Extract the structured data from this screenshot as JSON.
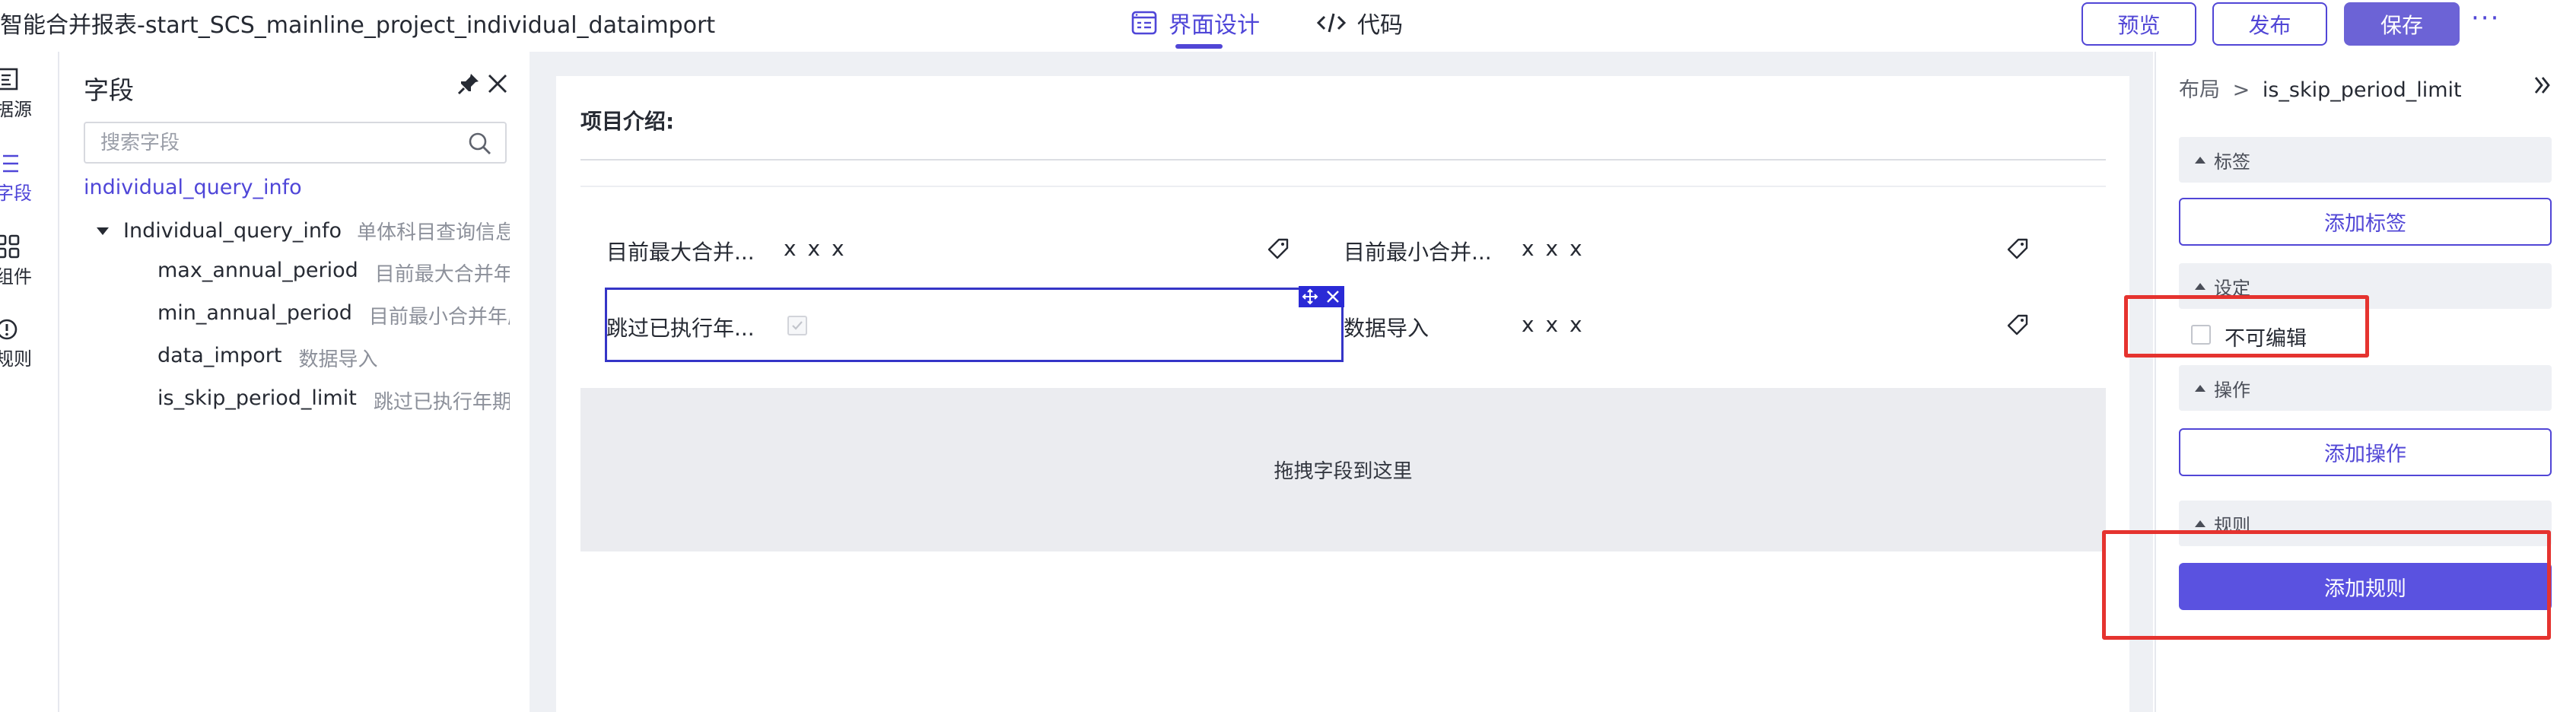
{
  "header": {
    "app_title": "智能合并报表-start_SCS_mainline_project_individual_dataimport",
    "tabs": [
      {
        "label": "界面设计",
        "icon": "layout-icon",
        "active": true
      },
      {
        "label": "代码",
        "icon": "code-icon",
        "active": false
      }
    ],
    "buttons": {
      "preview": "预览",
      "publish": "发布",
      "save": "保存",
      "more": "···"
    }
  },
  "rail": {
    "items": [
      {
        "label": "据源",
        "icon": "datasource-icon"
      },
      {
        "label": "字段",
        "icon": "list-icon",
        "active": true
      },
      {
        "label": "组件",
        "icon": "grid-icon"
      },
      {
        "label": "规则",
        "icon": "alert-circle-icon"
      }
    ]
  },
  "field_panel": {
    "title": "字段",
    "search_placeholder": "搜索字段",
    "source_link": "individual_query_info",
    "tree_root": {
      "name": "Individual_query_info",
      "desc": "单体科目查询信息"
    },
    "tree_children": [
      {
        "name": "max_annual_period",
        "desc": "目前最大合并年度"
      },
      {
        "name": "min_annual_period",
        "desc": "目前最小合并年度/"
      },
      {
        "name": "data_import",
        "desc": "数据导入"
      },
      {
        "name": "is_skip_period_limit",
        "desc": "跳过已执行年期限"
      }
    ]
  },
  "canvas": {
    "section_title": "项目介绍:",
    "rows": [
      {
        "left_label": "目前最大合并...",
        "left_value": "x x x",
        "right_label": "目前最小合并...",
        "right_value": "x x x"
      },
      {
        "left_label": "跳过已执行年...",
        "left_value": "",
        "right_label": "数据导入",
        "right_value": "x x x"
      }
    ],
    "drop_zone": "拖拽字段到这里"
  },
  "properties": {
    "breadcrumb_root": "布局",
    "breadcrumb_sep": ">",
    "breadcrumb_current": "is_skip_period_limit",
    "sections": {
      "tags": "标签",
      "settings": "设定",
      "actions": "操作",
      "rules": "规则"
    },
    "add_tag": "添加标签",
    "readonly_label": "不可编辑",
    "add_action": "添加操作",
    "add_rule": "添加规则"
  },
  "colors": {
    "accent": "#5146d6",
    "save_bg": "#6c63d6",
    "add_rule_bg": "#5a52e0",
    "highlight": "#e5332f",
    "canvas_bg": "#eef0f4"
  }
}
